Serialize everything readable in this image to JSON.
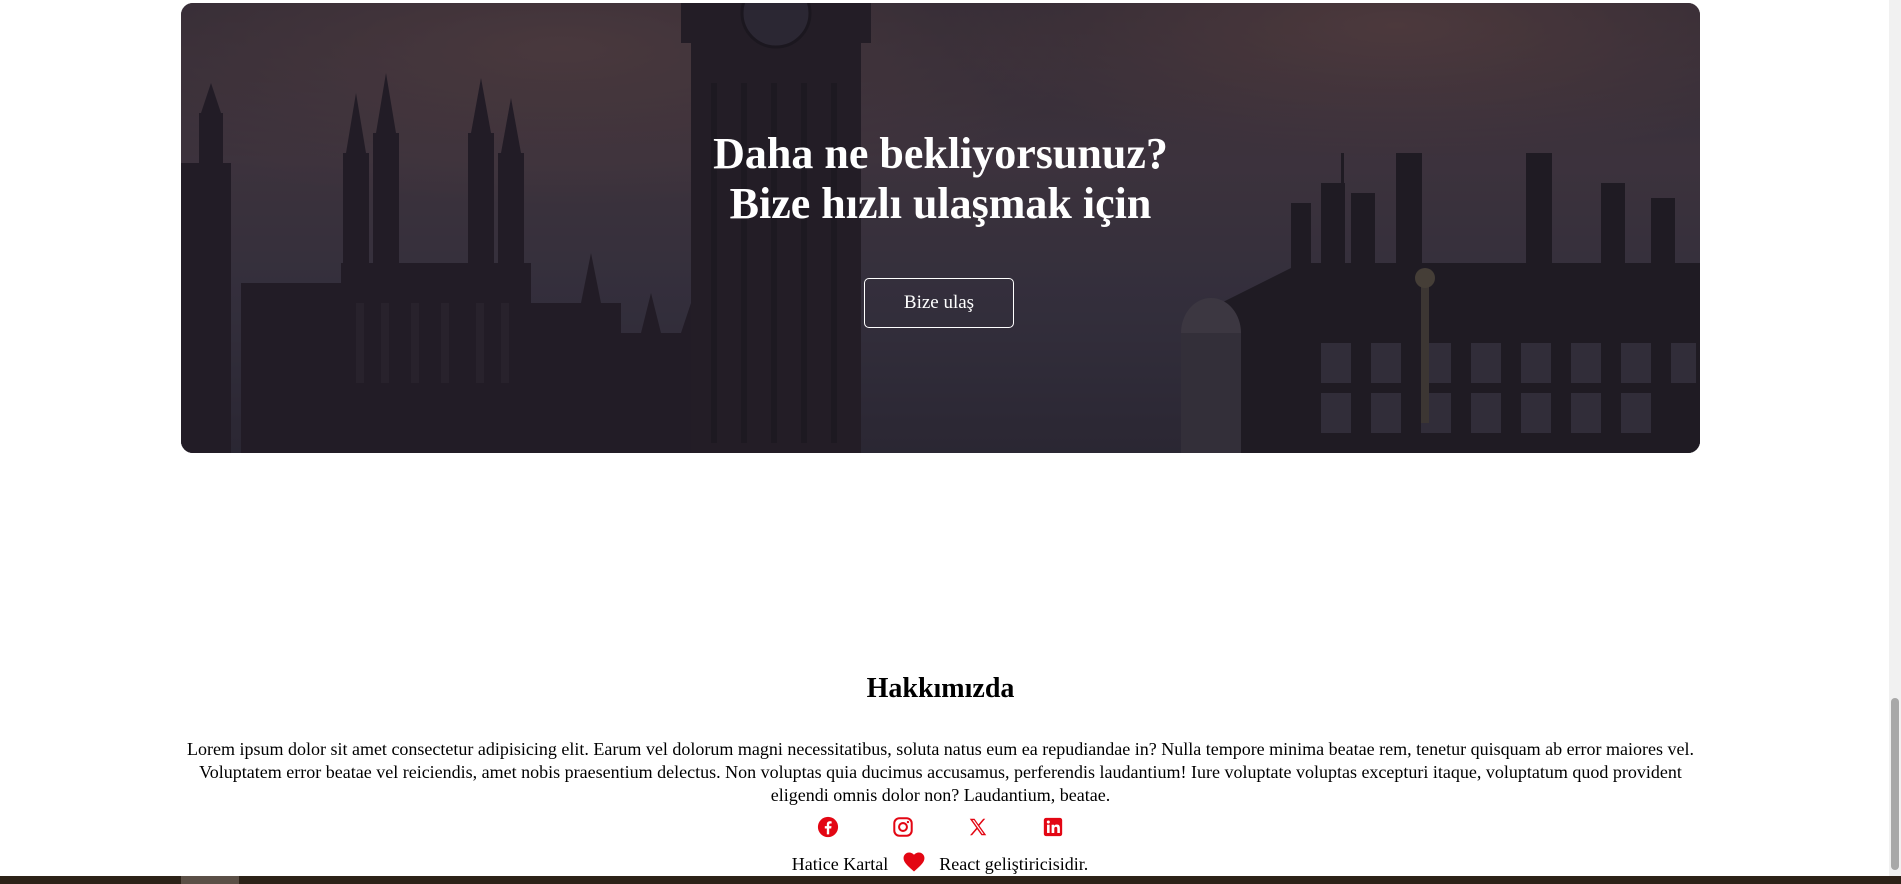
{
  "hero": {
    "title_line1": "Daha ne bekliyorsunuz?",
    "title_line2": "Bize hızlı ulaşmak için",
    "button_label": "Bize ulaş"
  },
  "about": {
    "title": "Hakkımızda",
    "text": "Lorem ipsum dolor sit amet consectetur adipisicing elit. Earum vel dolorum magni necessitatibus, soluta natus eum ea repudiandae in? Nulla tempore minima beatae rem, tenetur quisquam ab error maiores vel. Voluptatem error beatae vel reiciendis, amet nobis praesentium delectus. Non voluptas quia ducimus accusamus, perferendis laudantium! Iure voluptate voluptas excepturi itaque, voluptatum quod provident eligendi omnis dolor non? Laudantium, beatae."
  },
  "socials": [
    {
      "icon": "facebook-icon"
    },
    {
      "icon": "instagram-icon"
    },
    {
      "icon": "x-icon"
    },
    {
      "icon": "linkedin-icon"
    }
  ],
  "footer": {
    "author": "Hatice Kartal",
    "heart_icon": "heart-icon",
    "suffix": "React geliştiricisidir."
  },
  "colors": {
    "accent": "#e30613",
    "hero_overlay": "#2a2433",
    "text": "#000000"
  }
}
